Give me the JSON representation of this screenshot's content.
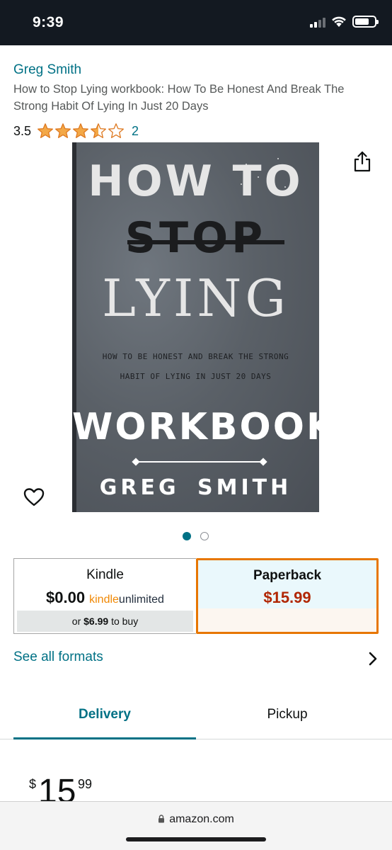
{
  "status_bar": {
    "time": "9:39"
  },
  "product": {
    "author": "Greg Smith",
    "title": "How to Stop Lying workbook: How To Be Honest And Break The Strong Habit Of Lying In Just 20 Days",
    "rating": "3.5",
    "rating_value": 3.5,
    "rating_max": 5,
    "rating_count": "2",
    "star_color": "#f3a847"
  },
  "cover": {
    "line1": "HOW TO",
    "line2": "STOP",
    "line3": "LYING",
    "subtitle_line1": "HOW TO BE HONEST AND BREAK THE STRONG",
    "subtitle_line2": "HABIT OF LYING IN JUST 20 DAYS",
    "line4": "WORKBOOK",
    "author": "GREG SMITH"
  },
  "carousel": {
    "total": 2,
    "active_index": 0
  },
  "formats": {
    "kindle": {
      "label": "Kindle",
      "price": "$0.00",
      "badge_kindle": "kindle",
      "badge_unlimited": "unlimited",
      "buy_prefix": "or",
      "buy_price": "$6.99",
      "buy_suffix": "to buy"
    },
    "paperback": {
      "label": "Paperback",
      "price": "$15.99",
      "selected": true
    },
    "see_all": "See all formats"
  },
  "tabs": {
    "delivery": "Delivery",
    "pickup": "Pickup",
    "active": "delivery"
  },
  "price": {
    "symbol": "$",
    "whole": "15",
    "fraction": "99"
  },
  "browser": {
    "url": "amazon.com"
  },
  "colors": {
    "link": "#007185",
    "price_red": "#b12704",
    "selected_border": "#e77600",
    "header_bg": "#131921"
  }
}
